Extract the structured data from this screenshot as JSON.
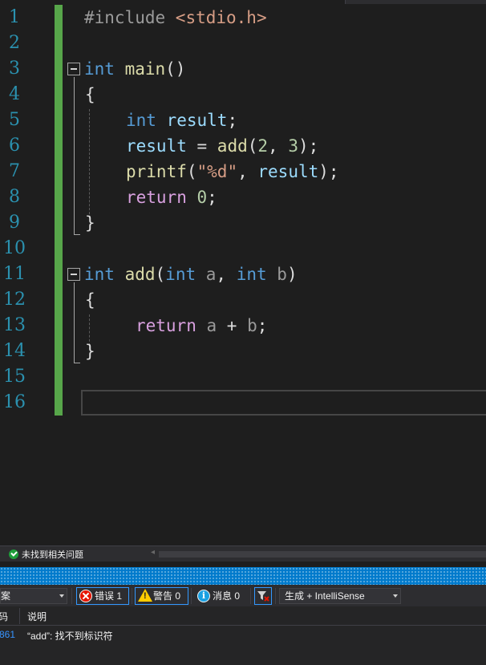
{
  "editor": {
    "line_numbers": [
      "1",
      "2",
      "3",
      "4",
      "5",
      "6",
      "7",
      "8",
      "9",
      "10",
      "11",
      "12",
      "13",
      "14",
      "15",
      "16"
    ],
    "code": {
      "l1_pp": "#include ",
      "l1_header": "<stdio.h>",
      "l3_type": "int",
      "l3_name": " main",
      "l3_parens": "()",
      "l4_brace": "{",
      "l5_type": "int",
      "l5_var": " result",
      "l5_semi": ";",
      "l6_var": "result",
      "l6_eq": " = ",
      "l6_fn": "add",
      "l6_open": "(",
      "l6_n2": "2",
      "l6_comma": ", ",
      "l6_n3": "3",
      "l6_close": ");",
      "l7_fn": "printf",
      "l7_open": "(",
      "l7_str": "\"%d\"",
      "l7_comma": ", ",
      "l7_var": "result",
      "l7_close": ");",
      "l8_kw": "return",
      "l8_sp": " ",
      "l8_num": "0",
      "l8_semi": ";",
      "l9_brace": "}",
      "l11_type": "int",
      "l11_name": " add",
      "l11_open": "(",
      "l11_type_a": "int",
      "l11_a": " a",
      "l11_comma": ", ",
      "l11_type_b": "int",
      "l11_b": " b",
      "l11_close": ")",
      "l12_brace": "{",
      "l13_kw": "return",
      "l13_a": " a",
      "l13_plus": " + ",
      "l13_b": "b",
      "l13_semi": ";",
      "l14_brace": "}"
    }
  },
  "status": {
    "issues_text": "未找到相关问题",
    "scroll_left": "◂"
  },
  "error_list": {
    "scope_value": "案",
    "errors_label": "错误 1",
    "warnings_label": "警告 0",
    "messages_label": "消息 0",
    "info_glyph": "i",
    "source_value": "生成 + IntelliSense",
    "columns": {
      "code": "码",
      "description": "说明"
    },
    "rows": [
      {
        "code": "861",
        "description": "“add”: 找不到标识符"
      }
    ]
  },
  "colors": {
    "keyword": "#569cd6",
    "control": "#d8a0df",
    "function": "#dcdcaa",
    "variable": "#9cdcfe",
    "string": "#d69d85",
    "number": "#b5cea8",
    "line_number": "#2b91af",
    "change_bar": "#57a64a",
    "accent": "#007acc"
  }
}
